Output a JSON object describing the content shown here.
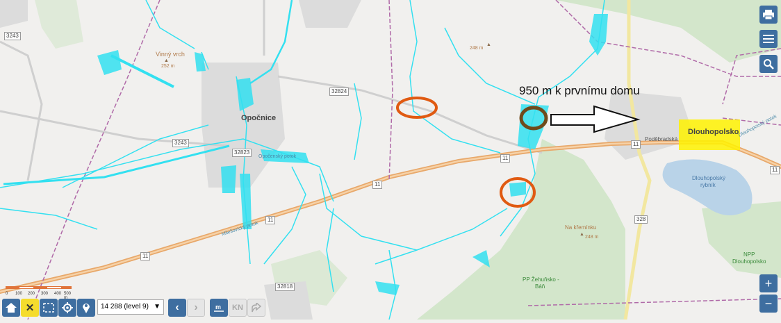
{
  "map": {
    "places": {
      "opocnice": "Opočnice",
      "dlouhopolsko": "Dlouhopolsko",
      "vinny_vrch": "Vinný vrch",
      "vinny_vrch_elev": "252 m",
      "elev_248_north": "248 m",
      "na_kreminku": "Na křemínku",
      "na_kreminku_elev": "248 m",
      "pp_zehunsko": "PP Žehuňsko -",
      "pp_zehunsko_2": "Báň",
      "npp_dlouhopolsko": "NPP",
      "npp_dlouhopolsko_2": "Dlouhopolsko",
      "pond": "Dlouhopolský",
      "pond_2": "rybník",
      "street_podebradska": "Poděbradská",
      "stream_milesovicky": "Milešovický potok",
      "stream_opocensky": "Opočenský potok",
      "stream_dlouhopolsky": "Dlouhopolský potok"
    },
    "roads": {
      "r3243_a": "3243",
      "r3243_b": "3243",
      "r32824": "32824",
      "r32823": "32823",
      "r32818": "32818",
      "r11_a": "11",
      "r11_b": "11",
      "r11_c": "11",
      "r11_d": "11",
      "r11_e": "11",
      "r11_f": "11",
      "r328": "328"
    },
    "annotation": "950 m k prvnímu domu"
  },
  "toolbar": {
    "zoom_select": "14 288 (level 9)",
    "kn_label": "KN"
  },
  "scale": {
    "ticks": [
      "0",
      "100",
      "200",
      "300",
      "400",
      "500 m"
    ]
  },
  "colors": {
    "water_overlay": "#33e0f0",
    "highway": "#e8a86a",
    "forest": "#cfe3c6",
    "boundary": "#b06aa8",
    "annotation_circle": "#e05a12",
    "highlight": "#fff200",
    "button_blue": "#3e6ea0"
  }
}
